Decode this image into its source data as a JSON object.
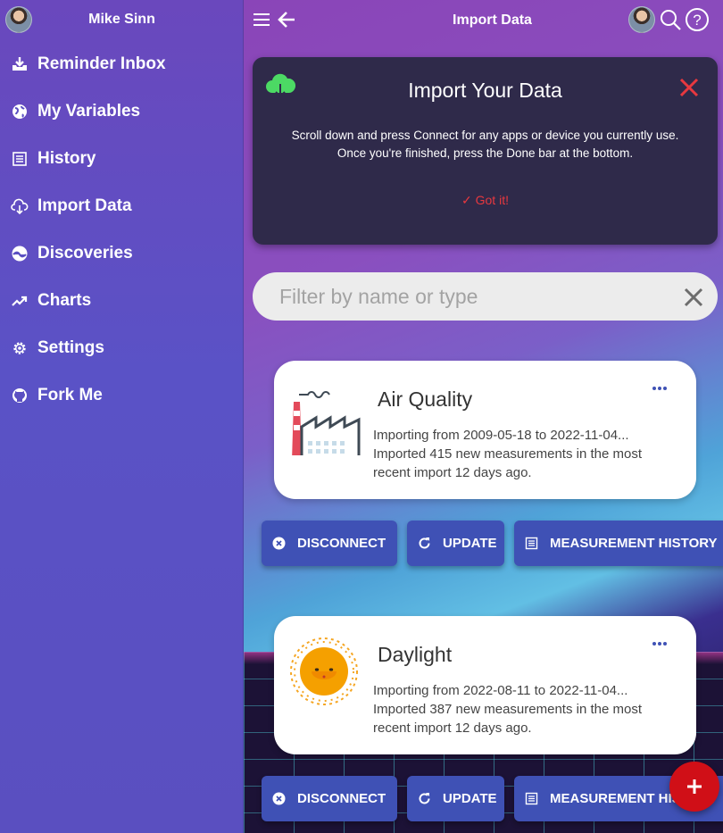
{
  "sidebar": {
    "user_name": "Mike Sinn",
    "items": [
      {
        "label": "Reminder Inbox",
        "icon": "inbox-download-icon"
      },
      {
        "label": "My Variables",
        "icon": "globe-icon"
      },
      {
        "label": "History",
        "icon": "list-icon"
      },
      {
        "label": "Import Data",
        "icon": "cloud-download-icon"
      },
      {
        "label": "Discoveries",
        "icon": "discoveries-icon"
      },
      {
        "label": "Charts",
        "icon": "trending-up-icon"
      },
      {
        "label": "Settings",
        "icon": "gear-icon"
      },
      {
        "label": "Fork Me",
        "icon": "github-icon"
      }
    ]
  },
  "header": {
    "title": "Import Data"
  },
  "info_card": {
    "title": "Import Your Data",
    "body_line1": "Scroll down and press Connect for any apps or device you currently use.",
    "body_line2": "Once you're finished, press the Done bar at the bottom.",
    "got_it_label": "Got it!"
  },
  "filter": {
    "placeholder": "Filter by name or type",
    "value": ""
  },
  "connectors": [
    {
      "name": "Air Quality",
      "description": "Importing from 2009-05-18 to 2022-11-04... Imported 415 new measurements in the most recent import 12 days ago.",
      "logo": "factory-icon",
      "disconnect_label": "DISCONNECT",
      "update_label": "UPDATE",
      "history_label": "MEASUREMENT HISTORY"
    },
    {
      "name": "Daylight",
      "description": "Importing from 2022-08-11 to 2022-11-04... Imported 387 new measurements in the most recent import 12 days ago.",
      "logo": "sun-icon",
      "disconnect_label": "DISCONNECT",
      "update_label": "UPDATE",
      "history_label": "MEASUREMENT HISTORY"
    }
  ],
  "fab_label": "+",
  "colors": {
    "accent_button": "#3f51b5",
    "fab": "#d00f17",
    "got_it": "#e8383f",
    "cloud": "#4cd964"
  }
}
